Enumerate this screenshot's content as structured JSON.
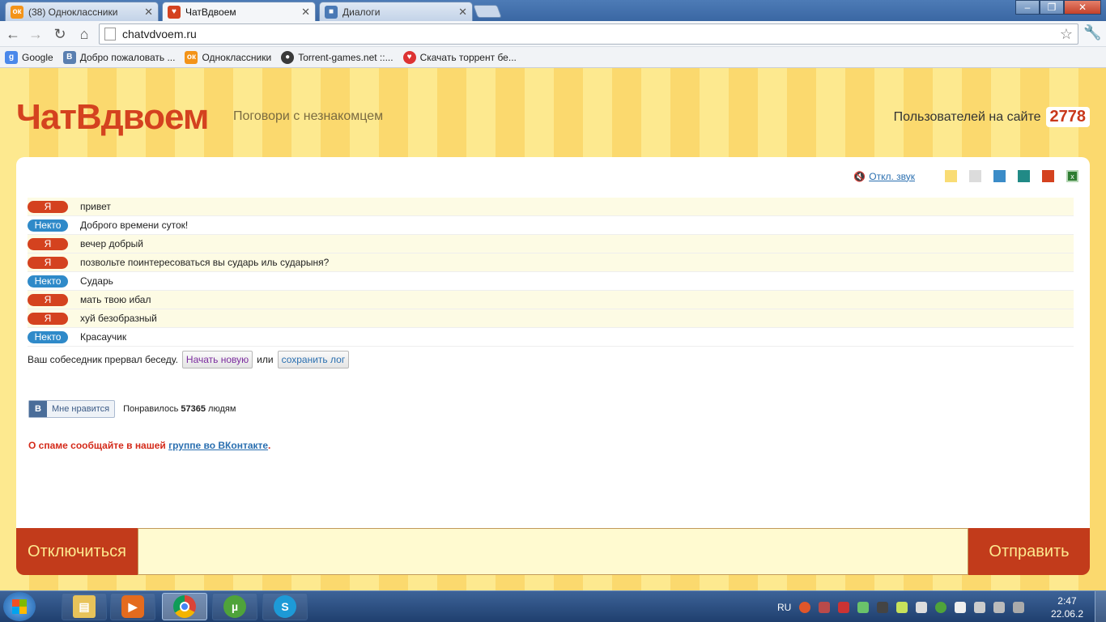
{
  "browser": {
    "tabs": [
      {
        "title": "(38) Одноклассники",
        "icon": "odnoklassniki-icon",
        "color": "#f39318",
        "glyph": "ок"
      },
      {
        "title": "ЧатВдвоем",
        "icon": "chat-bubble-icon",
        "color": "#d4421f",
        "glyph": "♥"
      },
      {
        "title": "Диалоги",
        "icon": "dialog-icon",
        "color": "#4a79b5",
        "glyph": "■"
      }
    ],
    "url": "chatvdvoem.ru",
    "bookmarks": [
      {
        "label": "Google",
        "icon": "google-icon",
        "color": "#4a88ea",
        "glyph": "g"
      },
      {
        "label": "Добро пожаловать ...",
        "icon": "vk-icon",
        "color": "#5a7fb0",
        "glyph": "B"
      },
      {
        "label": "Одноклассники",
        "icon": "odnoklassniki-icon",
        "color": "#f39318",
        "glyph": "ок"
      },
      {
        "label": "Torrent-games.net ::...",
        "icon": "torrent-games-icon",
        "color": "#3a3a3a",
        "glyph": "●"
      },
      {
        "label": "Скачать торрент бе...",
        "icon": "heart-icon",
        "color": "#d33",
        "glyph": "♥"
      }
    ]
  },
  "site": {
    "logo": "ЧатВдвоем",
    "tagline": "Поговори с незнакомцем",
    "users_label": "Пользователей на сайте",
    "users_count": "2778",
    "mute_label": "Откл. звук",
    "swatches": [
      "#f9dc75",
      "#dcdcdc",
      "#3b8cc8",
      "#218a86",
      "#d4421f"
    ],
    "messages": [
      {
        "who": "Я",
        "self": true,
        "text": "привет"
      },
      {
        "who": "Некто",
        "self": false,
        "text": "Доброго времени суток!"
      },
      {
        "who": "Я",
        "self": true,
        "text": "вечер добрый"
      },
      {
        "who": "Я",
        "self": true,
        "text": "позвольте поинтересоваться вы сударь иль сударыня?"
      },
      {
        "who": "Некто",
        "self": false,
        "text": "Сударь"
      },
      {
        "who": "Я",
        "self": true,
        "text": "мать твою ибал"
      },
      {
        "who": "Я",
        "self": true,
        "text": "хуй безобразный"
      },
      {
        "who": "Некто",
        "self": false,
        "text": "Красаучик"
      }
    ],
    "ended_text": "Ваш собеседник прервал беседу.",
    "new_chat": "Начать новую",
    "or": "или",
    "save_log": "сохранить лог",
    "vk_badge": "В",
    "like_button": "Мне нравится",
    "liked_prefix": "Понравилось",
    "liked_count": "57365",
    "liked_suffix": "людям",
    "spam_text": "О спаме сообщайте в нашей",
    "spam_link": "группе во ВКонтакте",
    "spam_end": ".",
    "disconnect": "Отключиться",
    "send": "Отправить",
    "message_value": ""
  },
  "taskbar": {
    "apps": [
      {
        "name": "explorer",
        "icon": "folder-icon",
        "color": "#e8c35a",
        "glyph": "▤"
      },
      {
        "name": "media-player",
        "icon": "media-player-icon",
        "color": "#e46b1e",
        "glyph": "▶"
      },
      {
        "name": "chrome",
        "icon": "chrome-icon",
        "color": "#3d9a3d",
        "glyph": "◉"
      },
      {
        "name": "utorrent",
        "icon": "utorrent-icon",
        "color": "#4fa33a",
        "glyph": "µ"
      },
      {
        "name": "skype",
        "icon": "skype-icon",
        "color": "#1d9ad7",
        "glyph": "S"
      }
    ],
    "lang": "RU",
    "time": "2:47",
    "date": "22.06.2"
  }
}
